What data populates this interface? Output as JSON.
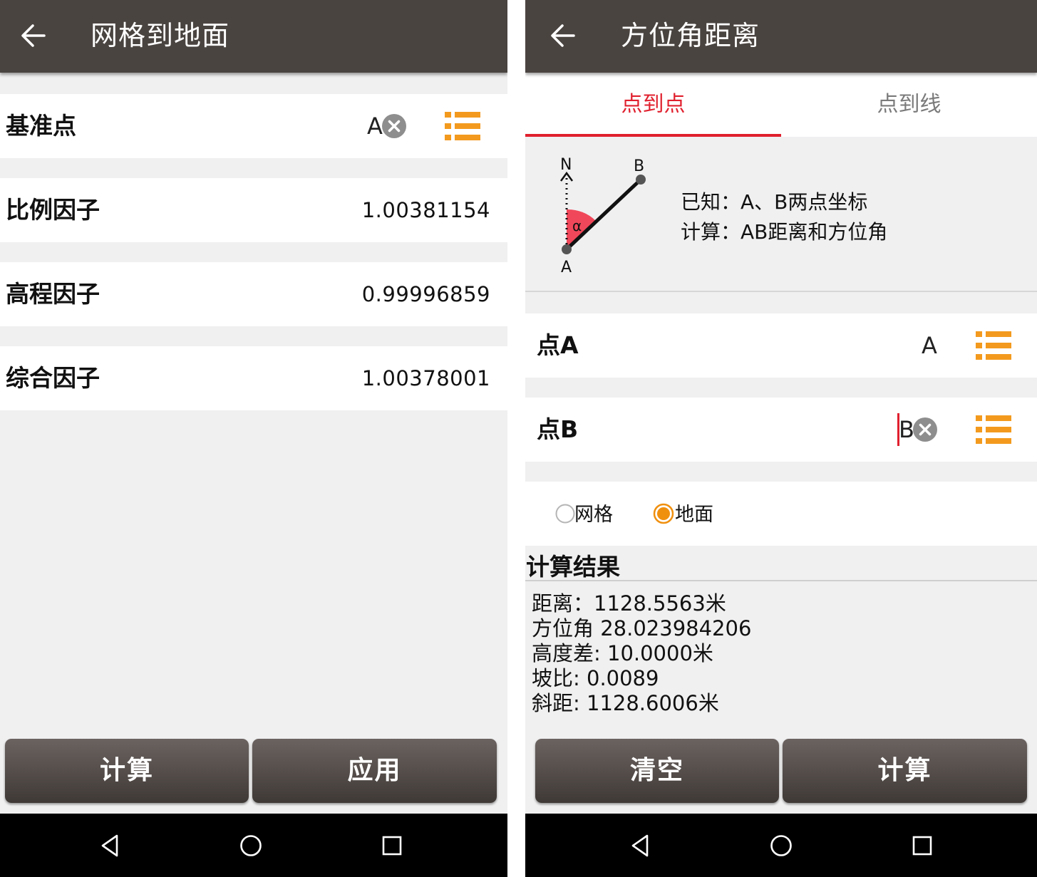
{
  "left": {
    "title": "网格到地面",
    "rows": [
      {
        "label": "基准点",
        "value": "A"
      },
      {
        "label": "比例因子",
        "value": "1.00381154"
      },
      {
        "label": "高程因子",
        "value": "0.99996859"
      },
      {
        "label": "综合因子",
        "value": "1.00378001"
      }
    ],
    "buttons": {
      "calculate": "计算",
      "apply": "应用"
    }
  },
  "right": {
    "title": "方位角距离",
    "tabs": [
      {
        "label": "点到点",
        "active": true
      },
      {
        "label": "点到线",
        "active": false
      }
    ],
    "diagram": {
      "n_label": "N",
      "a_label": "A",
      "b_label": "B",
      "alpha_label": "α",
      "known_text": "已知：A、B两点坐标",
      "calc_text": "计算：AB距离和方位角"
    },
    "point_a": {
      "label": "点A",
      "value": "A"
    },
    "point_b": {
      "label": "点B",
      "value": "B"
    },
    "radios": [
      {
        "label": "网格",
        "selected": false
      },
      {
        "label": "地面",
        "selected": true
      }
    ],
    "result_title": "计算结果",
    "results": {
      "distance": "距离：1128.5563米",
      "azimuth": "方位角 28.023984206",
      "height_diff": "高度差: 10.0000米",
      "slope_ratio": "坡比: 0.0089",
      "slope_distance": "斜距: 1128.6006米"
    },
    "buttons": {
      "clear": "清空",
      "calculate": "计算"
    }
  },
  "colors": {
    "appbar": "#4a4440",
    "accent_red": "#e0202e",
    "accent_orange": "#f39a1e",
    "radio_orange": "#f0900f"
  },
  "icons": [
    "back-arrow-icon",
    "clear-icon",
    "list-icon",
    "nav-back-icon",
    "nav-home-icon",
    "nav-recents-icon"
  ]
}
